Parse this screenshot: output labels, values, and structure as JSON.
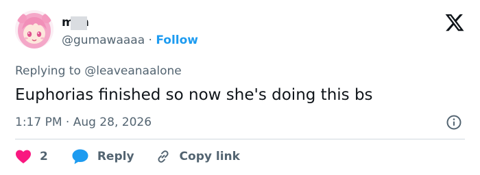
{
  "author": {
    "display_name": "mch",
    "handle": "@gumawaaaa",
    "separator": "·",
    "follow_label": "Follow"
  },
  "tweet": {
    "replying_prefix": "Replying to ",
    "replying_to": "@leaveanaalone",
    "text": "Euphorias finished so now she's doing this bs",
    "timestamp": "1:17 PM · Aug 28, 2026"
  },
  "actions": {
    "like_count": "2",
    "reply_label": "Reply",
    "copy_link_label": "Copy link"
  },
  "colors": {
    "like": "#f91880",
    "reply": "#1d9bf0",
    "follow": "#1d9bf0",
    "muted": "#536471",
    "text": "#0f1419"
  },
  "icons": {
    "brand": "x-logo-icon",
    "info": "info-icon",
    "like": "heart-icon",
    "reply": "speech-bubble-icon",
    "copy": "link-icon"
  }
}
